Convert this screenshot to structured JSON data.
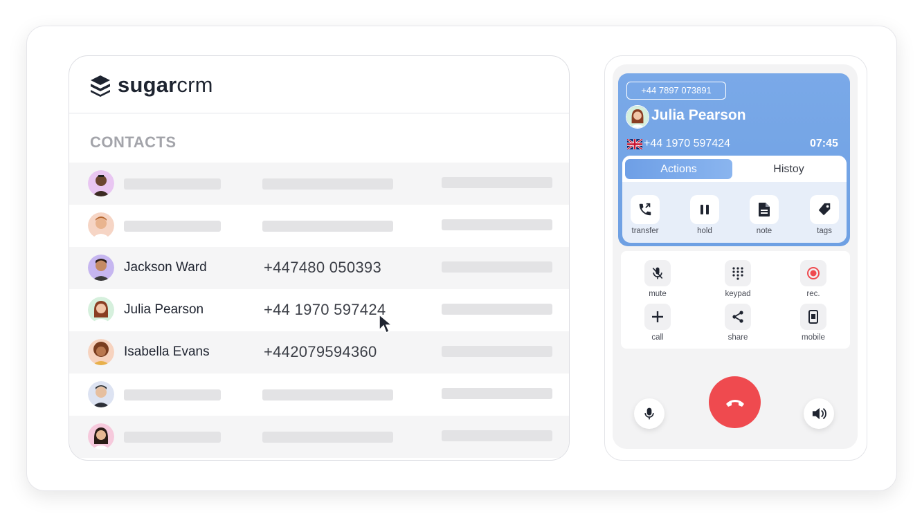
{
  "crm": {
    "logo_bold": "sugar",
    "logo_light": "crm",
    "section_title": "CONTACTS",
    "contacts": [
      {
        "name": "Jackson Ward",
        "phone": "+447480 050393"
      },
      {
        "name": "Julia Pearson",
        "phone": "+44 1970 597424"
      },
      {
        "name": "Isabella Evans",
        "phone": "+442079594360"
      }
    ]
  },
  "phone": {
    "dialed_number": "+44 7897 073891",
    "caller_name": "Julia Pearson",
    "caller_phone": "+44 1970 597424",
    "call_timer": "07:45",
    "tabs": [
      "Actions",
      "Histoy"
    ],
    "actions": [
      "transfer",
      "hold",
      "note",
      "tags"
    ],
    "controls": [
      "mute",
      "keypad",
      "rec.",
      "call",
      "share",
      "mobile"
    ],
    "colors": {
      "accent": "#7aa9e8",
      "hangup": "#ef4a4f",
      "record": "#ef4a4f"
    }
  }
}
